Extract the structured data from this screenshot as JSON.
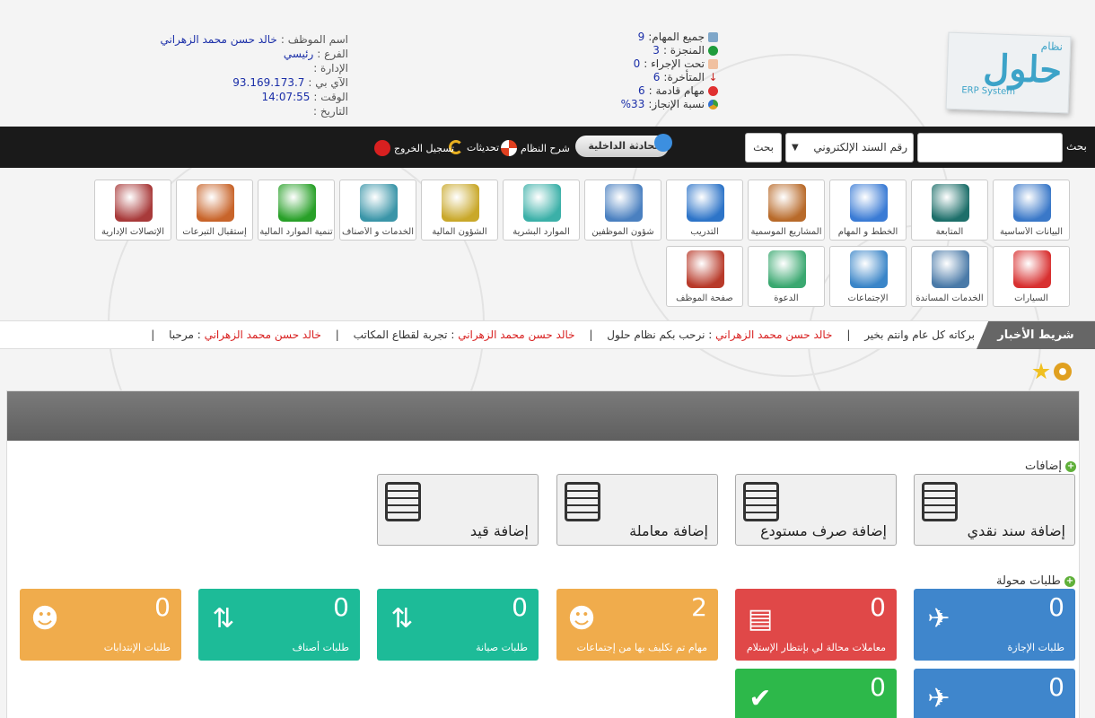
{
  "logo": {
    "small": "نظام",
    "big": "حلول",
    "sub": "ERP System"
  },
  "stats": [
    {
      "label": "جميع المهام:",
      "value": "9",
      "color": "#7fa7c9"
    },
    {
      "label": "المنجزة :",
      "value": "3",
      "color": "#1e9c3c"
    },
    {
      "label": "تحت الإجراء :",
      "value": "0",
      "color": "#e06020"
    },
    {
      "label": "المتأخرة:",
      "value": "6",
      "color": "#c8201c"
    },
    {
      "label": "مهام قادمة :",
      "value": "6",
      "color": "#e03030"
    },
    {
      "label": "نسبة الإنجاز:",
      "value": "%33",
      "color": "#3aa03a"
    }
  ],
  "userinfo": [
    {
      "label": "اسم الموظف :",
      "value": "خالد حسن محمد الزهراني"
    },
    {
      "label": "الفرع :",
      "value": "رئيسي"
    },
    {
      "label": "الإدارة :",
      "value": ""
    },
    {
      "label": "الآي بي :",
      "value": "93.169.173.7"
    },
    {
      "label": "الوقت :",
      "value": "14:07:55"
    },
    {
      "label": "التاريخ :",
      "value": ""
    }
  ],
  "topbar": {
    "search_label": "بحث",
    "search_select": "رقم السند الإلكتروني",
    "search_button": "بحث",
    "chat": "المحادثة الداخلية",
    "help": "شرح النظام",
    "updates": "تحديثات",
    "logout": "تسجيل الخروج"
  },
  "modules_row1": [
    {
      "label": "البيانات الأساسية",
      "icon": "gear-icon",
      "color": "#3a78c8"
    },
    {
      "label": "المتابعة",
      "icon": "radar-icon",
      "color": "#1d6f6a"
    },
    {
      "label": "الخطط و المهام",
      "icon": "planner-icon",
      "color": "#3a7bd5"
    },
    {
      "label": "المشاريع الموسمية",
      "icon": "briefcase-icon",
      "color": "#b86a2a"
    },
    {
      "label": "التدريب",
      "icon": "graduation-cap-icon",
      "color": "#2d74c8"
    },
    {
      "label": "شؤون الموظفين",
      "icon": "employee-icon",
      "color": "#4a80c0"
    },
    {
      "label": "الموارد البشرية",
      "icon": "people-gears-icon",
      "color": "#3bb0a8"
    },
    {
      "label": "الشؤون المالية",
      "icon": "money-icon",
      "color": "#c9a82a"
    },
    {
      "label": "الخدمات و الأصناف",
      "icon": "warehouse-icon",
      "color": "#3a95a8"
    },
    {
      "label": "تنمية الموارد المالية",
      "icon": "growth-chart-icon",
      "color": "#28a028"
    },
    {
      "label": "إستقبال التبرعات",
      "icon": "donations-icon",
      "color": "#c8642a"
    },
    {
      "label": "الإتصالات الإدارية",
      "icon": "binders-icon",
      "color": "#a83a3a"
    }
  ],
  "modules_row2": [
    {
      "label": "السيارات",
      "icon": "car-icon",
      "color": "#d83030"
    },
    {
      "label": "الخدمات المساندة",
      "icon": "tools-icon",
      "color": "#4a7aa8"
    },
    {
      "label": "الإجتماعات",
      "icon": "meeting-icon",
      "color": "#3a85c8"
    },
    {
      "label": "الدعوة",
      "icon": "dawah-icon",
      "color": "#3aa870"
    },
    {
      "label": "صفحة الموظف",
      "icon": "employee-page-icon",
      "color": "#b83a2a"
    }
  ],
  "news": {
    "label": "شريط الأخبار",
    "items": [
      {
        "text": "بركاته كل عام وانتم بخير",
        "name": ""
      },
      {
        "text": " : نرحب بكم نظام حلول",
        "name": "خالد حسن محمد الزهراني"
      },
      {
        "text": " : تجربة لقطاع المكاتب",
        "name": "خالد حسن محمد الزهراني"
      },
      {
        "text": " : مرحبا",
        "name": "خالد حسن محمد الزهراني"
      }
    ]
  },
  "additions": {
    "title": "إضافات",
    "cards": [
      {
        "label": "إضافة سند نقدي",
        "icon": "cash-voucher-icon"
      },
      {
        "label": "إضافة صرف مستودع",
        "icon": "warehouse-out-icon"
      },
      {
        "label": "إضافة معاملة",
        "icon": "document-icon"
      },
      {
        "label": "إضافة قيد",
        "icon": "document-icon"
      }
    ]
  },
  "requests": {
    "title": "طلبات محولة",
    "tiles": [
      {
        "label": "طلبات الإجازة",
        "value": "0",
        "color": "#3f86cc",
        "icon": "plane-icon"
      },
      {
        "label": "معاملات محالة لي بإنتظار الإستلام",
        "value": "0",
        "color": "#e04848",
        "icon": "papers-icon"
      },
      {
        "label": "مهام تم تكليف بها من إجتماعات",
        "value": "2",
        "color": "#f0ac4c",
        "icon": "meeting-people-icon"
      },
      {
        "label": "طلبات صيانة",
        "value": "0",
        "color": "#1dbb98",
        "icon": "up-down-arrows-icon"
      },
      {
        "label": "طلبات أصناف",
        "value": "0",
        "color": "#1dbb98",
        "icon": "up-down-arrows-icon"
      },
      {
        "label": "طلبات الإنتدابات",
        "value": "0",
        "color": "#f0ac4c",
        "icon": "meeting-people-icon"
      }
    ],
    "tiles_row2": [
      {
        "label": "",
        "value": "0",
        "color": "#3f86cc",
        "icon": "plane-icon"
      },
      {
        "label": "",
        "value": "0",
        "color": "#2db84a",
        "icon": "check-icon"
      }
    ]
  }
}
